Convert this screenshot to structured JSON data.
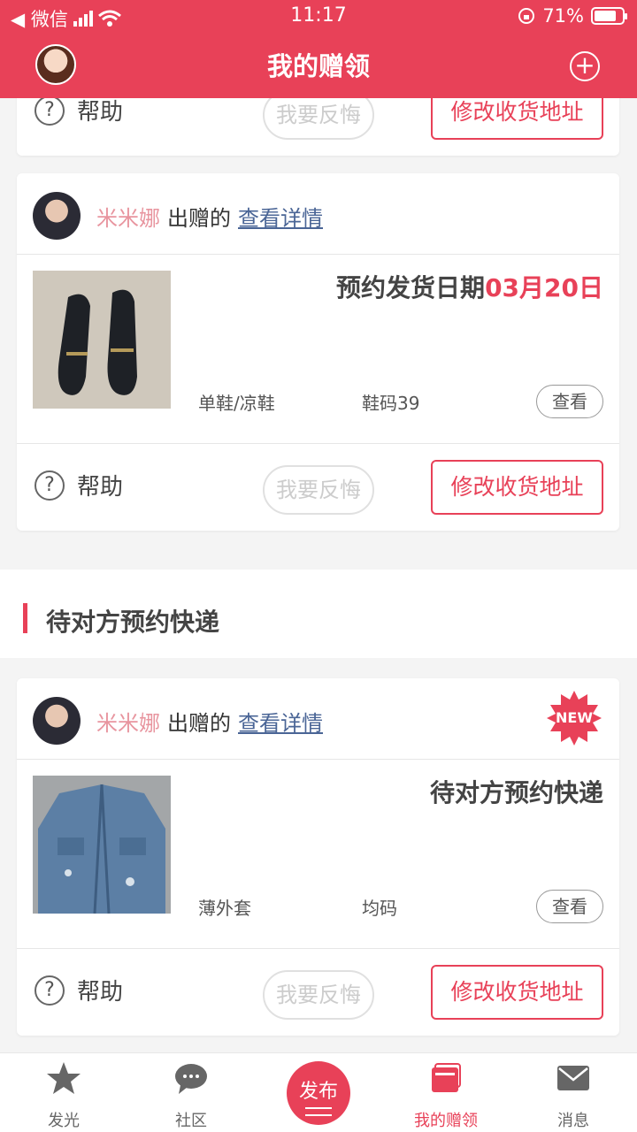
{
  "status_bar": {
    "carrier": "◀ 微信",
    "time": "11:17",
    "battery": "71%"
  },
  "header": {
    "title": "我的赠领"
  },
  "colors": {
    "brand": "#e84158",
    "link": "#4a6596",
    "giver_name": "#e8959f"
  },
  "card_top": {
    "help_label": "帮助",
    "regret_label": "我要反悔",
    "modify_label": "修改收货地址"
  },
  "card1": {
    "giver_name": "米米娜",
    "verb": "出赠的",
    "detail_link": "查看详情",
    "status_prefix": "预约发货日期",
    "status_date": "03月20日",
    "category": "单鞋/凉鞋",
    "size": "鞋码39",
    "view_label": "查看",
    "help_label": "帮助",
    "regret_label": "我要反悔",
    "modify_label": "修改收货地址"
  },
  "section": {
    "title": "待对方预约快递"
  },
  "card2": {
    "giver_name": "米米娜",
    "verb": "出赠的",
    "detail_link": "查看详情",
    "badge": "NEW",
    "status": "待对方预约快递",
    "category": "薄外套",
    "size": "均码",
    "view_label": "查看",
    "help_label": "帮助",
    "regret_label": "我要反悔",
    "modify_label": "修改收货地址"
  },
  "tabbar": {
    "items": [
      {
        "label": "发光",
        "icon": "star-icon"
      },
      {
        "label": "社区",
        "icon": "chat-bubble-icon"
      },
      {
        "label": "发布",
        "icon": "publish-icon"
      },
      {
        "label": "我的赠领",
        "icon": "gift-cards-icon"
      },
      {
        "label": "消息",
        "icon": "mail-icon"
      }
    ]
  }
}
